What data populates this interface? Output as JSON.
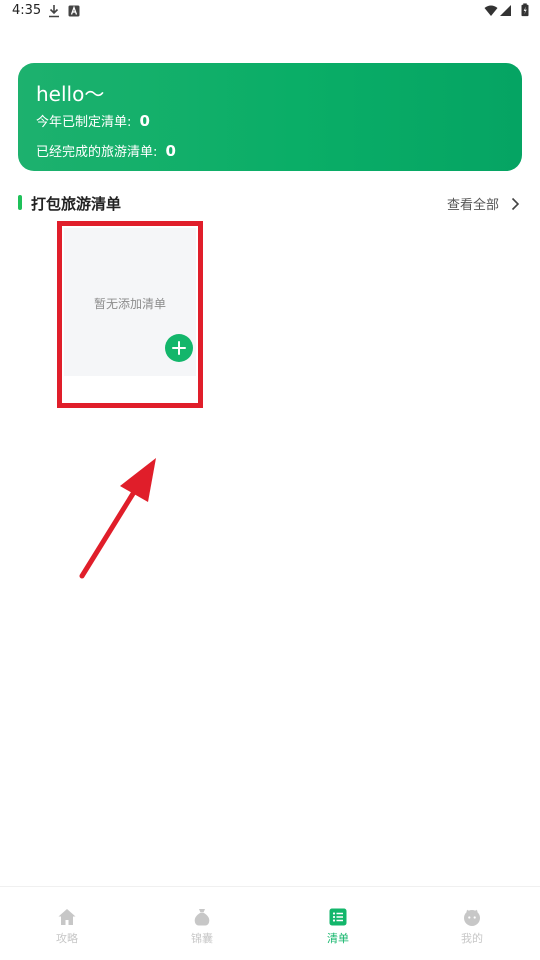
{
  "status_bar": {
    "time": "4:35",
    "icons": [
      "download-icon",
      "a-icon",
      "wifi-icon",
      "signal-icon",
      "battery-icon"
    ]
  },
  "hero": {
    "greeting": "hello～",
    "yearly_label": "今年已制定清单:",
    "yearly_count": "0",
    "completed_label": "已经完成的旅游清单:",
    "completed_count": "0",
    "gradient_colors": [
      "#1db16e",
      "#05a463"
    ]
  },
  "section": {
    "title": "打包旅游清单",
    "see_all": "查看全部",
    "accent_color": "#1fc15a"
  },
  "empty_card": {
    "message": "暂无添加清单",
    "add_icon": "plus-icon"
  },
  "annotation": {
    "color": "#e01e2a"
  },
  "bottom_nav": {
    "items": [
      {
        "label": "攻略",
        "icon": "home-icon",
        "active": false
      },
      {
        "label": "锦囊",
        "icon": "bag-icon",
        "active": false
      },
      {
        "label": "清单",
        "icon": "list-icon",
        "active": true
      },
      {
        "label": "我的",
        "icon": "face-icon",
        "active": false
      }
    ],
    "active_color": "#13b66b",
    "inactive_color": "#c7c7c7"
  }
}
